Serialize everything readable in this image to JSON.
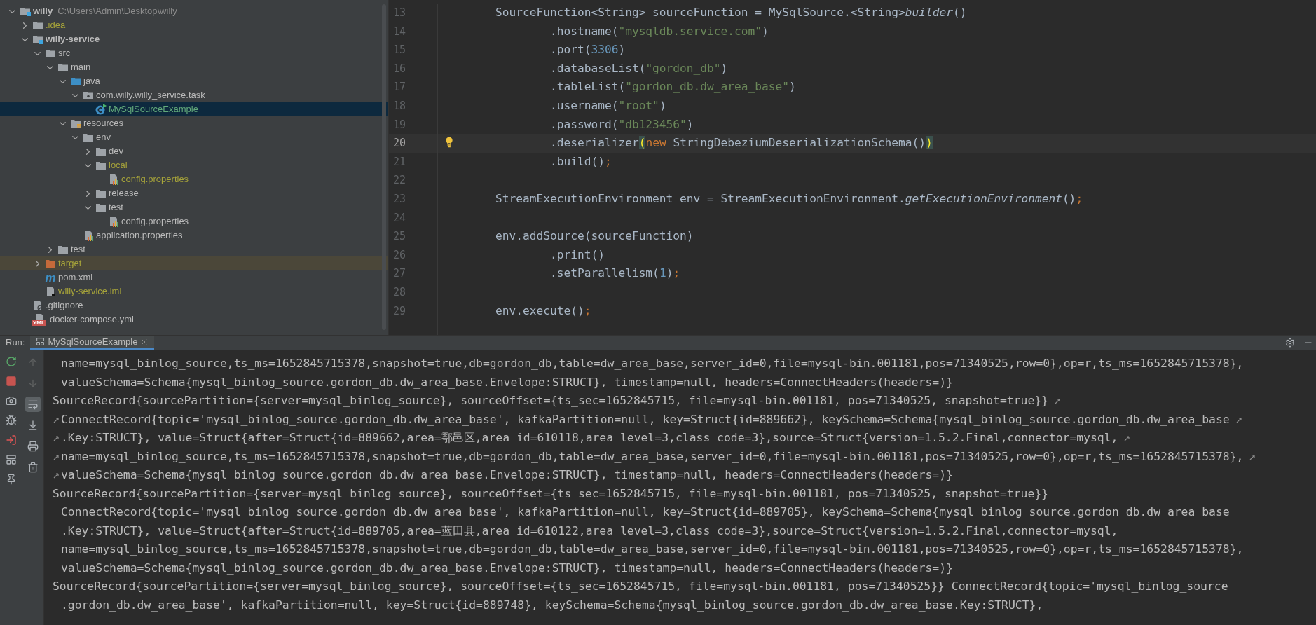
{
  "project_tree": [
    {
      "label": "willy",
      "path": "C:\\Users\\Admin\\Desktop\\willy",
      "kind": "module",
      "ignored": false,
      "added": false,
      "selected": false,
      "expanded": true,
      "children": [
        {
          "label": ".idea",
          "kind": "folder",
          "ignored": true,
          "added": false,
          "selected": false,
          "expanded": false
        },
        {
          "label": "willy-service",
          "kind": "module",
          "ignored": false,
          "added": false,
          "selected": false,
          "expanded": true,
          "children": [
            {
              "label": "src",
              "kind": "folder",
              "ignored": false,
              "added": false,
              "selected": false,
              "expanded": true,
              "children": [
                {
                  "label": "main",
                  "kind": "folder",
                  "ignored": false,
                  "added": false,
                  "selected": false,
                  "expanded": true,
                  "children": [
                    {
                      "label": "java",
                      "kind": "source",
                      "ignored": false,
                      "added": false,
                      "selected": false,
                      "expanded": true,
                      "children": [
                        {
                          "label": "com.willy.willy_service.task",
                          "kind": "package",
                          "ignored": false,
                          "added": false,
                          "selected": false,
                          "expanded": true,
                          "children": [
                            {
                              "label": "MySqlSourceExample",
                              "kind": "class",
                              "ignored": false,
                              "added": true,
                              "selected": true
                            }
                          ]
                        }
                      ]
                    },
                    {
                      "label": "resources",
                      "kind": "resources",
                      "ignored": false,
                      "added": false,
                      "selected": false,
                      "expanded": true,
                      "children": [
                        {
                          "label": "env",
                          "kind": "folder",
                          "ignored": false,
                          "added": false,
                          "selected": false,
                          "expanded": true,
                          "children": [
                            {
                              "label": "dev",
                              "kind": "folder",
                              "ignored": false,
                              "added": false,
                              "selected": false,
                              "expanded": false
                            },
                            {
                              "label": "local",
                              "kind": "folder",
                              "ignored": true,
                              "added": false,
                              "selected": false,
                              "expanded": true,
                              "children": [
                                {
                                  "label": "config.properties",
                                  "kind": "properties",
                                  "ignored": true,
                                  "added": false,
                                  "selected": false
                                }
                              ]
                            },
                            {
                              "label": "release",
                              "kind": "folder",
                              "ignored": false,
                              "added": false,
                              "selected": false,
                              "expanded": false
                            },
                            {
                              "label": "test",
                              "kind": "folder",
                              "ignored": false,
                              "added": false,
                              "selected": false,
                              "expanded": true,
                              "children": [
                                {
                                  "label": "config.properties",
                                  "kind": "properties",
                                  "ignored": false,
                                  "added": false,
                                  "selected": false
                                }
                              ]
                            }
                          ]
                        },
                        {
                          "label": "application.properties",
                          "kind": "properties",
                          "ignored": false,
                          "added": false,
                          "selected": false
                        }
                      ]
                    }
                  ]
                },
                {
                  "label": "test",
                  "kind": "folder",
                  "ignored": false,
                  "added": false,
                  "selected": false,
                  "expanded": false
                }
              ]
            },
            {
              "label": "target",
              "kind": "excluded",
              "ignored": true,
              "added": false,
              "selected": false,
              "expanded": false
            },
            {
              "label": "pom.xml",
              "kind": "maven",
              "icon_glyph": "m",
              "ignored": false,
              "added": false,
              "selected": false
            },
            {
              "label": "willy-service.iml",
              "kind": "iml",
              "ignored": true,
              "added": false,
              "selected": false
            }
          ]
        },
        {
          "label": ".gitignore",
          "kind": "gitignore",
          "ignored": false,
          "added": false,
          "selected": false
        },
        {
          "label": "docker-compose.yml",
          "kind": "yml",
          "icon_glyph": "YML",
          "ignored": false,
          "added": false,
          "selected": false
        }
      ]
    }
  ],
  "editor": {
    "lines": [
      {
        "number": "13",
        "current": false,
        "tokens": [
          {
            "text": "        SourceFunction<String> sourceFunction = MySqlSource.<String>",
            "kind": "plain"
          },
          {
            "text": "builder",
            "kind": "italic"
          },
          {
            "text": "()",
            "kind": "plain"
          }
        ]
      },
      {
        "number": "14",
        "current": false,
        "tokens": [
          {
            "text": "                .hostname(",
            "kind": "plain"
          },
          {
            "text": "\"mysqldb.service.com\"",
            "kind": "string"
          },
          {
            "text": ")",
            "kind": "plain"
          }
        ]
      },
      {
        "number": "15",
        "current": false,
        "tokens": [
          {
            "text": "                .port(",
            "kind": "plain"
          },
          {
            "text": "3306",
            "kind": "number"
          },
          {
            "text": ")",
            "kind": "plain"
          }
        ]
      },
      {
        "number": "16",
        "current": false,
        "tokens": [
          {
            "text": "                .databaseList(",
            "kind": "plain"
          },
          {
            "text": "\"gordon_db\"",
            "kind": "string"
          },
          {
            "text": ")",
            "kind": "plain"
          }
        ]
      },
      {
        "number": "17",
        "current": false,
        "tokens": [
          {
            "text": "                .tableList(",
            "kind": "plain"
          },
          {
            "text": "\"gordon_db.dw_area_base\"",
            "kind": "string"
          },
          {
            "text": ")",
            "kind": "plain"
          }
        ]
      },
      {
        "number": "18",
        "current": false,
        "tokens": [
          {
            "text": "                .username(",
            "kind": "plain"
          },
          {
            "text": "\"root\"",
            "kind": "string"
          },
          {
            "text": ")",
            "kind": "plain"
          }
        ]
      },
      {
        "number": "19",
        "current": false,
        "tokens": [
          {
            "text": "                .password(",
            "kind": "plain"
          },
          {
            "text": "\"db123456\"",
            "kind": "string"
          },
          {
            "text": ")",
            "kind": "plain"
          }
        ]
      },
      {
        "number": "20",
        "current": true,
        "bulb": true,
        "tokens": [
          {
            "text": "                .deserializer",
            "kind": "plain"
          },
          {
            "text": "(",
            "kind": "brace"
          },
          {
            "text": "new",
            "kind": "keyword"
          },
          {
            "text": " StringDebeziumDeserializationSchema()",
            "kind": "plain"
          },
          {
            "text": ")",
            "kind": "brace"
          }
        ]
      },
      {
        "number": "21",
        "current": false,
        "tokens": [
          {
            "text": "                .build()",
            "kind": "plain"
          },
          {
            "text": ";",
            "kind": "keyword"
          }
        ]
      },
      {
        "number": "22",
        "current": false
      },
      {
        "number": "23",
        "current": false,
        "tokens": [
          {
            "text": "        StreamExecutionEnvironment env = StreamExecutionEnvironment.",
            "kind": "plain"
          },
          {
            "text": "getExecutionEnvironment",
            "kind": "italic"
          },
          {
            "text": "()",
            "kind": "plain"
          },
          {
            "text": ";",
            "kind": "keyword"
          }
        ]
      },
      {
        "number": "24",
        "current": false
      },
      {
        "number": "25",
        "current": false,
        "tokens": [
          {
            "text": "        env.addSource(sourceFunction)",
            "kind": "plain"
          }
        ]
      },
      {
        "number": "26",
        "current": false,
        "tokens": [
          {
            "text": "                .print()",
            "kind": "plain"
          }
        ]
      },
      {
        "number": "27",
        "current": false,
        "tokens": [
          {
            "text": "                .setParallelism(",
            "kind": "plain"
          },
          {
            "text": "1",
            "kind": "number"
          },
          {
            "text": ")",
            "kind": "plain"
          },
          {
            "text": ";",
            "kind": "keyword"
          }
        ]
      },
      {
        "number": "28",
        "current": false
      },
      {
        "number": "29",
        "current": false,
        "tokens": [
          {
            "text": "        env.execute()",
            "kind": "plain"
          },
          {
            "text": ";",
            "kind": "keyword"
          }
        ]
      }
    ]
  },
  "run_panel": {
    "label": "Run:",
    "tabs": [
      {
        "label": "MySqlSourceExample",
        "selected": true
      }
    ],
    "run_toolbar": [
      {
        "kind": "rerun"
      },
      {
        "kind": "stop"
      },
      {
        "kind": "camera"
      },
      {
        "kind": "debug"
      },
      {
        "kind": "attach"
      },
      {
        "kind": "layout"
      },
      {
        "kind": "pin"
      }
    ],
    "console_toolbar": [
      {
        "kind": "up",
        "disabled": true,
        "selected": false
      },
      {
        "kind": "down",
        "disabled": true,
        "selected": false
      },
      {
        "kind": "soft-wrap",
        "disabled": false,
        "selected": true
      },
      {
        "kind": "scroll-end",
        "disabled": false,
        "selected": false
      },
      {
        "kind": "print",
        "disabled": false,
        "selected": false
      },
      {
        "kind": "clear",
        "disabled": false,
        "selected": false
      }
    ],
    "console": [
      {
        "text": "name=mysql_binlog_source,ts_ms=1652845715378,snapshot=true,db=gordon_db,table=dw_area_base,server_id=0,file=mysql-bin.001181,pos=71340525,row=0},op=r,ts_ms=1652845715378},",
        "continued": true,
        "wrap_start": false,
        "wrap_end": false
      },
      {
        "text": "valueSchema=Schema{mysql_binlog_source.gordon_db.dw_area_base.Envelope:STRUCT}, timestamp=null, headers=ConnectHeaders(headers=)}",
        "continued": true,
        "wrap_start": false,
        "wrap_end": false
      },
      {
        "text": "SourceRecord{sourcePartition={server=mysql_binlog_source}, sourceOffset={ts_sec=1652845715, file=mysql-bin.001181, pos=71340525, snapshot=true}}",
        "continued": false,
        "wrap_start": false,
        "wrap_end": true
      },
      {
        "text": "ConnectRecord{topic='mysql_binlog_source.gordon_db.dw_area_base', kafkaPartition=null, key=Struct{id=889662}, keySchema=Schema{mysql_binlog_source.gordon_db.dw_area_base",
        "continued": true,
        "wrap_start": true,
        "wrap_end": true
      },
      {
        "text": ".Key:STRUCT}, value=Struct{after=Struct{id=889662,area=鄠邑区,area_id=610118,area_level=3,class_code=3},source=Struct{version=1.5.2.Final,connector=mysql,",
        "continued": true,
        "wrap_start": true,
        "wrap_end": true
      },
      {
        "text": "name=mysql_binlog_source,ts_ms=1652845715378,snapshot=true,db=gordon_db,table=dw_area_base,server_id=0,file=mysql-bin.001181,pos=71340525,row=0},op=r,ts_ms=1652845715378},",
        "continued": true,
        "wrap_start": true,
        "wrap_end": true
      },
      {
        "text": "valueSchema=Schema{mysql_binlog_source.gordon_db.dw_area_base.Envelope:STRUCT}, timestamp=null, headers=ConnectHeaders(headers=)}",
        "continued": true,
        "wrap_start": true,
        "wrap_end": false
      },
      {
        "text": "SourceRecord{sourcePartition={server=mysql_binlog_source}, sourceOffset={ts_sec=1652845715, file=mysql-bin.001181, pos=71340525, snapshot=true}}",
        "continued": false,
        "wrap_start": false,
        "wrap_end": false
      },
      {
        "text": "ConnectRecord{topic='mysql_binlog_source.gordon_db.dw_area_base', kafkaPartition=null, key=Struct{id=889705}, keySchema=Schema{mysql_binlog_source.gordon_db.dw_area_base",
        "continued": true,
        "wrap_start": false,
        "wrap_end": false
      },
      {
        "text": ".Key:STRUCT}, value=Struct{after=Struct{id=889705,area=蓝田县,area_id=610122,area_level=3,class_code=3},source=Struct{version=1.5.2.Final,connector=mysql,",
        "continued": true,
        "wrap_start": false,
        "wrap_end": false
      },
      {
        "text": "name=mysql_binlog_source,ts_ms=1652845715378,snapshot=true,db=gordon_db,table=dw_area_base,server_id=0,file=mysql-bin.001181,pos=71340525,row=0},op=r,ts_ms=1652845715378},",
        "continued": true,
        "wrap_start": false,
        "wrap_end": false
      },
      {
        "text": "valueSchema=Schema{mysql_binlog_source.gordon_db.dw_area_base.Envelope:STRUCT}, timestamp=null, headers=ConnectHeaders(headers=)}",
        "continued": true,
        "wrap_start": false,
        "wrap_end": false
      },
      {
        "text": "SourceRecord{sourcePartition={server=mysql_binlog_source}, sourceOffset={ts_sec=1652845715, file=mysql-bin.001181, pos=71340525}} ConnectRecord{topic='mysql_binlog_source",
        "continued": false,
        "wrap_start": false,
        "wrap_end": false
      },
      {
        "text": ".gordon_db.dw_area_base', kafkaPartition=null, key=Struct{id=889748}, keySchema=Schema{mysql_binlog_source.gordon_db.dw_area_base.Key:STRUCT},",
        "continued": true,
        "wrap_start": false,
        "wrap_end": false
      }
    ]
  }
}
